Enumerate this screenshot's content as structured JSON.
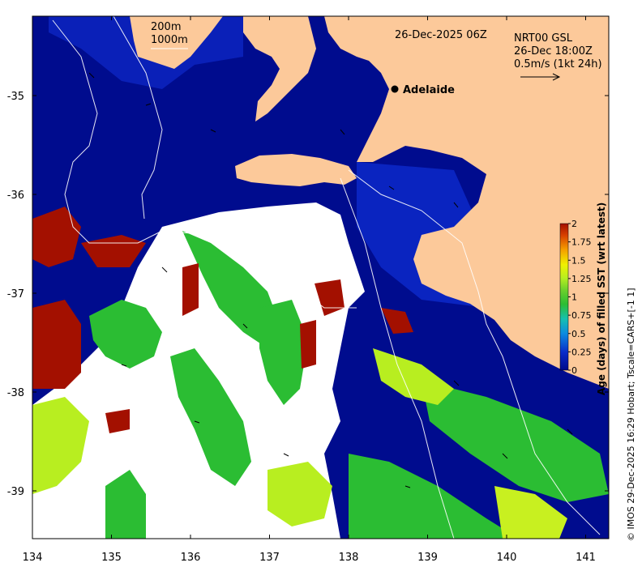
{
  "map": {
    "date_label": "26-Dec-2025 06Z",
    "product": {
      "line1": "NRT00 GSL",
      "line2": "26-Dec 18:00Z",
      "line3": "0.5m/s (1kt 24h)"
    },
    "contour_legend": {
      "depth1": "200m",
      "depth2": "1000m"
    },
    "city": "Adelaide",
    "credit": "© IMOS 29-Dec-2025 16:29 Hobart; Tscale=CARS+[-1 1]",
    "x_ticks": [
      "134",
      "135",
      "136",
      "137",
      "138",
      "139",
      "140",
      "141"
    ],
    "y_ticks": [
      "-35",
      "-36",
      "-37",
      "-38",
      "-39"
    ],
    "colors": {
      "land": "#fcc99a",
      "sea_fresh": "#000c8e",
      "age_low": "#0a2bc8",
      "age_mid": "#2bbd33",
      "age_1_25": "#b8ee20",
      "age_high": "#a31000",
      "no_data": "#ffffff"
    }
  },
  "colorbar": {
    "title": "Age (days) of filled SST (wrt latest)",
    "ticks": [
      "2",
      "1.75",
      "1.5",
      "1.25",
      "1",
      "0.75",
      "0.5",
      "0.25",
      "0"
    ]
  }
}
